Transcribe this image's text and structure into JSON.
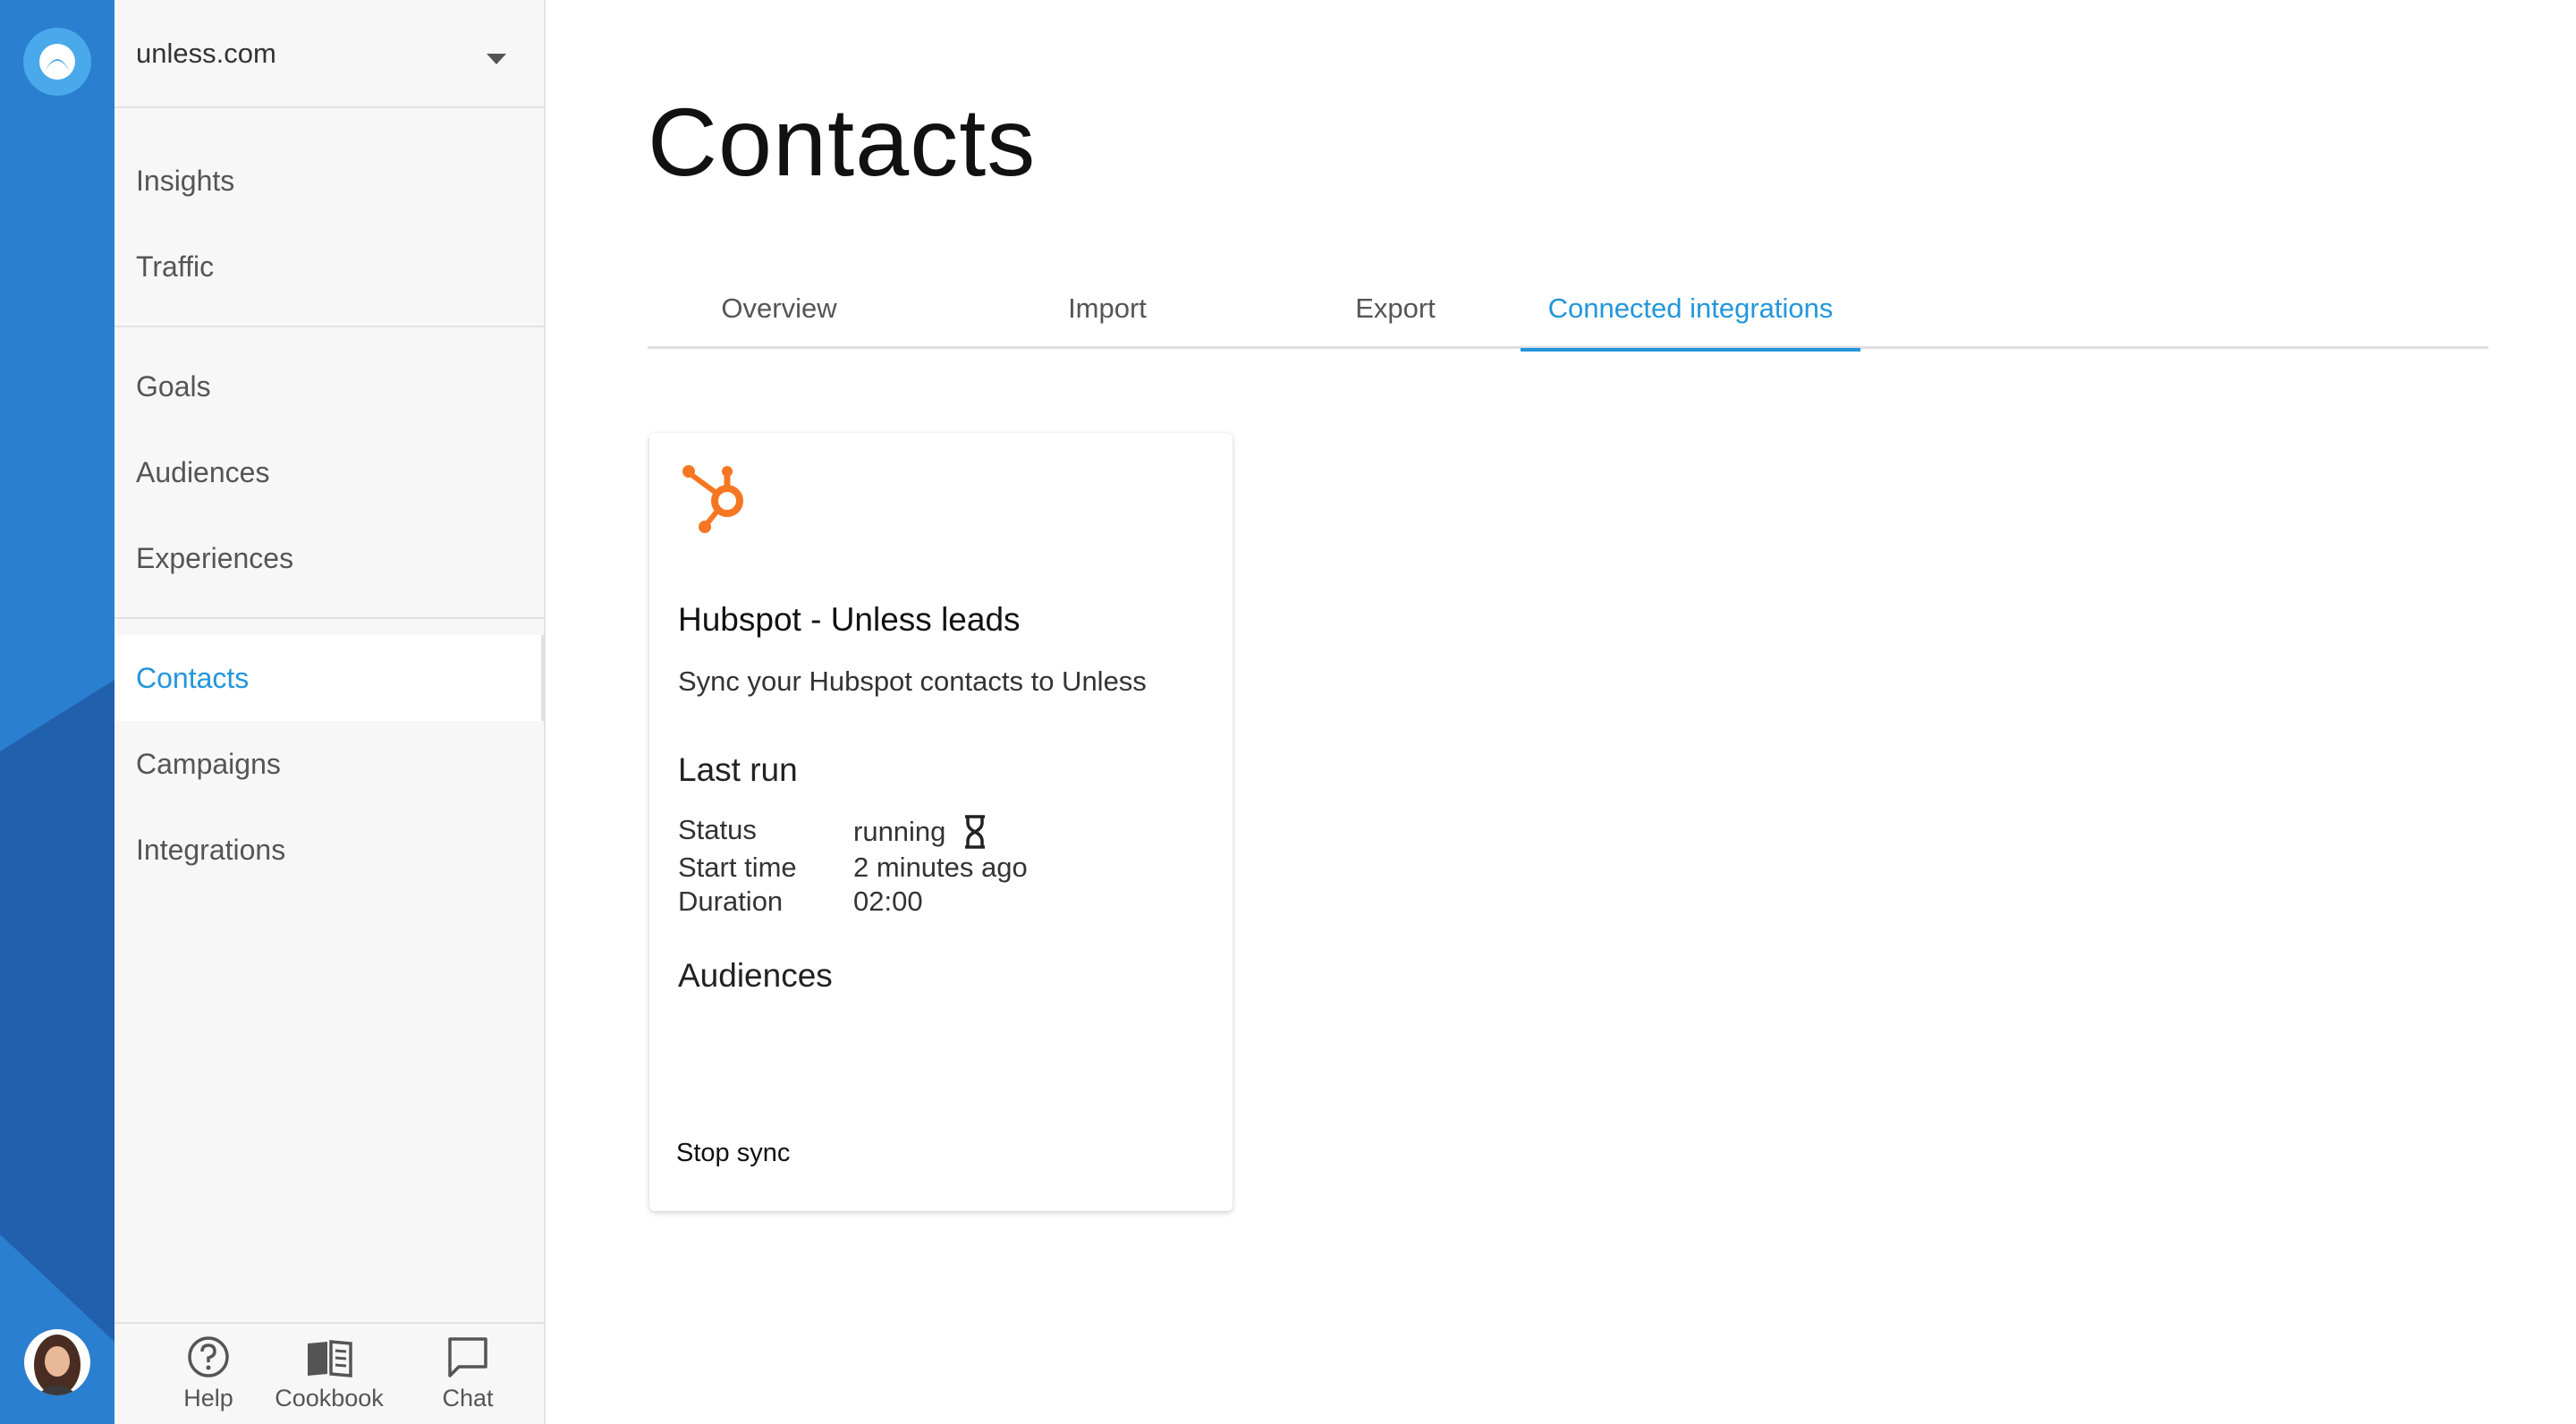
{
  "site_selector": {
    "value": "unless.com"
  },
  "sidebar": {
    "groups": [
      {
        "items": [
          {
            "label": "Insights"
          },
          {
            "label": "Traffic"
          }
        ]
      },
      {
        "items": [
          {
            "label": "Goals"
          },
          {
            "label": "Audiences"
          },
          {
            "label": "Experiences"
          }
        ]
      },
      {
        "items": [
          {
            "label": "Contacts",
            "active": true
          },
          {
            "label": "Campaigns"
          },
          {
            "label": "Integrations"
          }
        ]
      }
    ]
  },
  "bottom_bar": {
    "help": "Help",
    "cookbook": "Cookbook",
    "chat": "Chat"
  },
  "page": {
    "title": "Contacts"
  },
  "tabs": [
    {
      "label": "Overview"
    },
    {
      "label": "Import"
    },
    {
      "label": "Export"
    },
    {
      "label": "Connected integrations",
      "active": true
    }
  ],
  "integration_card": {
    "logo_icon": "hubspot-icon",
    "title": "Hubspot - Unless leads",
    "description": "Sync your Hubspot contacts to Unless",
    "last_run_heading": "Last run",
    "status_label": "Status",
    "status_value": "running",
    "status_icon": "hourglass-icon",
    "start_time_label": "Start time",
    "start_time_value": "2 minutes ago",
    "duration_label": "Duration",
    "duration_value": "02:00",
    "audiences_heading": "Audiences",
    "stop_button": "Stop sync"
  },
  "colors": {
    "accent": "#2396dc",
    "rail_blue": "#2a7fd0",
    "hubspot_orange": "#f57722"
  }
}
